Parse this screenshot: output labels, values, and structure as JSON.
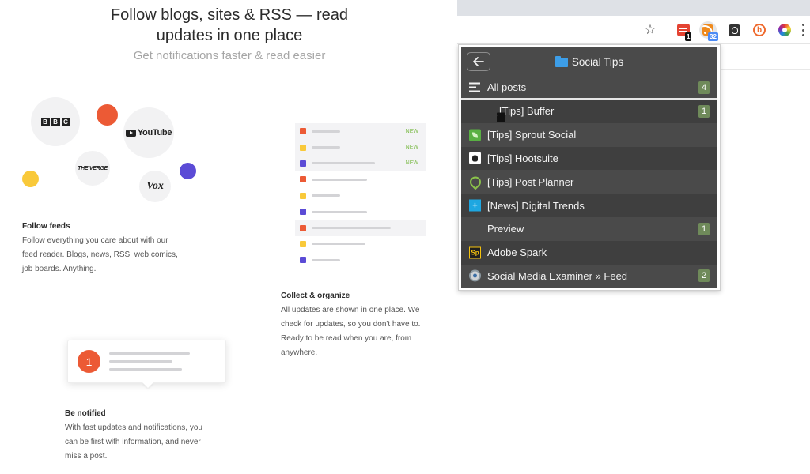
{
  "hero": {
    "title_line1": "Follow blogs, sites & RSS — read",
    "title_line2": "updates in one place",
    "subtitle": "Get notifications faster & read easier"
  },
  "logos": {
    "bbc": [
      "B",
      "B",
      "C"
    ],
    "youtube": "YouTube",
    "verge": "THE VERGE",
    "vox": "Vox"
  },
  "features": {
    "follow": {
      "title": "Follow feeds",
      "lines": [
        "Follow everything you care about with our",
        "feed reader. Blogs, news, RSS, web comics,",
        "job boards. Anything."
      ]
    },
    "collect": {
      "title": "Collect & organize",
      "lines": [
        "All updates are shown in one place. We",
        "check for updates, so you don't have to.",
        "Ready to be read when you are, from",
        "anywhere."
      ]
    },
    "notify": {
      "title": "Be notified",
      "lines": [
        "With fast updates and notifications, you",
        "can be first with information, and never",
        "miss a post."
      ],
      "badge": "1"
    }
  },
  "feed_illustration": {
    "new_label": "NEW",
    "rows": [
      {
        "color": "#ec5a35",
        "is_new": true
      },
      {
        "color": "#f9c93a",
        "is_new": true
      },
      {
        "color": "#5b4bd6",
        "is_new": true
      },
      {
        "color": "#ec5a35",
        "is_new": false
      },
      {
        "color": "#f9c93a",
        "is_new": false
      },
      {
        "color": "#5b4bd6",
        "is_new": false
      },
      {
        "color": "#ec5a35",
        "is_new": false
      },
      {
        "color": "#f9c93a",
        "is_new": false
      },
      {
        "color": "#5b4bd6",
        "is_new": false
      }
    ]
  },
  "toolbar": {
    "icons": [
      "star-icon",
      "todoist-icon",
      "rss-feeder-icon",
      "bulb-icon",
      "b-icon",
      "color-wheel-icon",
      "menu-icon"
    ],
    "todoist_badge": "1",
    "rss_badge": "32",
    "todoist_badge_color": "#111111",
    "rss_badge_color": "#4c8bf5"
  },
  "popup": {
    "title": "Social Tips",
    "back_icon": "arrow-left-icon",
    "folder_icon": "folder-icon",
    "all_posts": {
      "label": "All posts",
      "count": "4"
    },
    "feeds": [
      {
        "label": "[Tips] Buffer",
        "count": "1",
        "icon": "buffer-icon"
      },
      {
        "label": "[Tips] Sprout Social",
        "count": "",
        "icon": "sprout-social-icon"
      },
      {
        "label": "[Tips] Hootsuite",
        "count": "",
        "icon": "hootsuite-icon"
      },
      {
        "label": "[Tips] Post Planner",
        "count": "",
        "icon": "post-planner-icon"
      },
      {
        "label": "[News] Digital Trends",
        "count": "",
        "icon": "digital-trends-icon"
      },
      {
        "label": "Preview",
        "count": "1",
        "icon": "preview-icon"
      },
      {
        "label": "Adobe Spark",
        "count": "",
        "icon": "adobe-spark-icon"
      },
      {
        "label": "Social Media Examiner » Feed",
        "count": "2",
        "icon": "social-media-examiner-icon"
      }
    ],
    "spark_glyph": "Sp",
    "dt_glyph": "+",
    "count_color": "#6f8a5a"
  },
  "colors": {
    "orange": "#ec5a35",
    "yellow": "#f9c93a",
    "purple": "#5b4bd6",
    "popup_bg": "#4a4a4a"
  }
}
